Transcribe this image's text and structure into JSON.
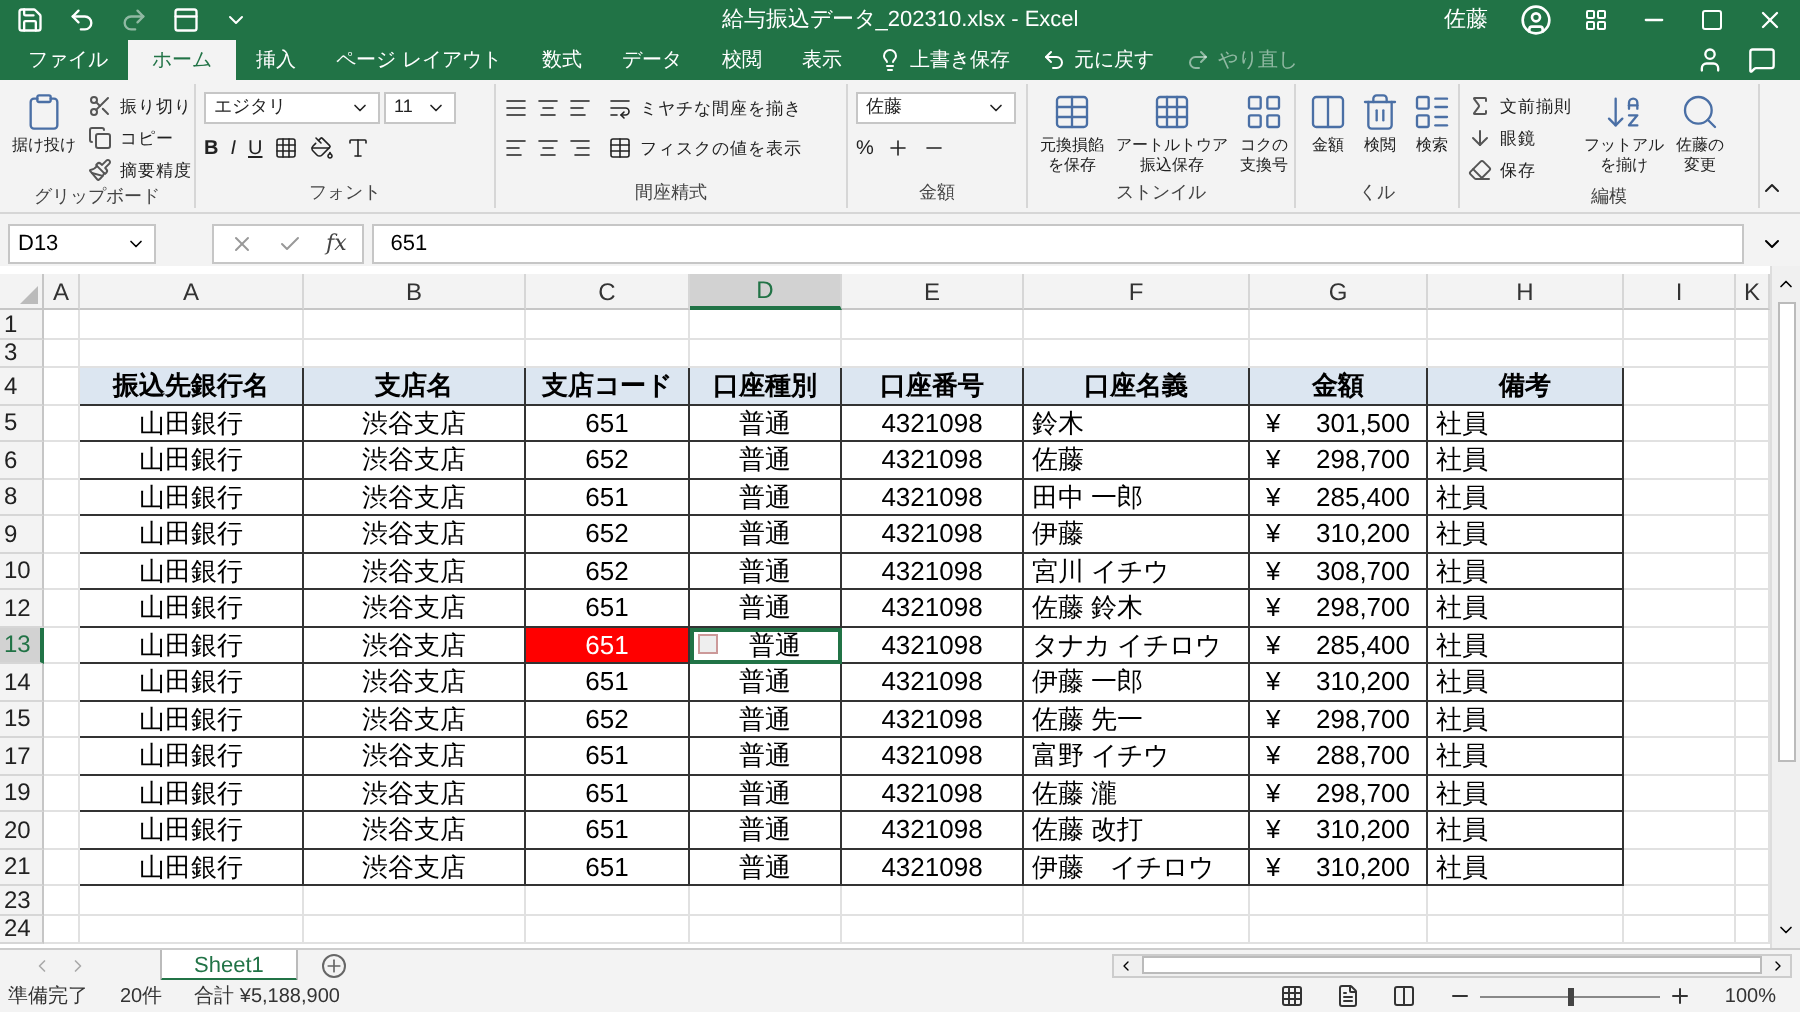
{
  "window": {
    "title": "給与振込データ_202310.xlsx - Excel",
    "user": "佐藤"
  },
  "ribbon_tabs": [
    {
      "label": "ファイル",
      "selected": false
    },
    {
      "label": "ホーム",
      "selected": true
    },
    {
      "label": "挿入",
      "selected": false
    },
    {
      "label": "ページ レイアウト",
      "selected": false
    },
    {
      "label": "数式",
      "selected": false
    },
    {
      "label": "データ",
      "selected": false
    },
    {
      "label": "校閲",
      "selected": false
    },
    {
      "label": "表示",
      "selected": false
    }
  ],
  "quick_commands": [
    {
      "label": "上書き保存",
      "disabled": false
    },
    {
      "label": "元に戻す",
      "disabled": false
    },
    {
      "label": "やり直し",
      "disabled": true
    }
  ],
  "ribbon_groups": [
    {
      "label": "グリップボード",
      "large": [
        {
          "lines": [
            "据け投け"
          ]
        }
      ],
      "small": [
        "振り切り",
        "コピー",
        "摘要精度"
      ]
    },
    {
      "label": "フォント",
      "fields": [
        "エジタリ",
        "11"
      ],
      "styles": [
        "B",
        "I",
        "U"
      ]
    },
    {
      "label": "間座精式",
      "small": [
        "ミヤチな間座を揃き",
        "フィスクの値を表示"
      ]
    },
    {
      "label": "金額",
      "fields": [
        "佐藤"
      ],
      "styles": [
        "%"
      ]
    },
    {
      "label": "ストンイル",
      "large": [
        {
          "lines": [
            "元換損餡",
            "を保存"
          ]
        },
        {
          "lines": [
            "アートルトウア",
            "振込保存"
          ]
        },
        {
          "lines": [
            "コクの",
            "支換号"
          ]
        }
      ]
    },
    {
      "label": "くル",
      "large": [
        {
          "lines": [
            "金額"
          ]
        },
        {
          "lines": [
            "検閲"
          ]
        },
        {
          "lines": [
            "検索"
          ]
        }
      ]
    },
    {
      "label": "編模",
      "small": [
        "文前揃則",
        "眼鏡",
        "保存"
      ],
      "large": [
        {
          "lines": [
            "フットアル",
            "を揃け"
          ]
        },
        {
          "lines": [
            "佐藤の",
            "変更"
          ]
        }
      ]
    }
  ],
  "formula_bar": {
    "name_box": "D13",
    "function_label": "fx",
    "value": "651"
  },
  "columns": [
    {
      "label": "A",
      "selected": false
    },
    {
      "label": "A",
      "selected": false
    },
    {
      "label": "B",
      "selected": false
    },
    {
      "label": "C",
      "selected": false
    },
    {
      "label": "D",
      "selected": true
    },
    {
      "label": "E",
      "selected": false
    },
    {
      "label": "F",
      "selected": false
    },
    {
      "label": "G",
      "selected": false
    },
    {
      "label": "H",
      "selected": false
    },
    {
      "label": "I",
      "selected": false
    },
    {
      "label": "K",
      "selected": false
    }
  ],
  "rows": [
    {
      "number": "1",
      "kind": "empty",
      "selected": false
    },
    {
      "number": "3",
      "kind": "empty",
      "selected": false
    },
    {
      "number": "4",
      "kind": "header",
      "selected": false,
      "cells": [
        "振込先銀行名",
        "支店名",
        "支店コード",
        "口座種別",
        "口座番号",
        "口座名義",
        "金額",
        "備考"
      ]
    },
    {
      "number": "5",
      "kind": "data",
      "selected": false,
      "cells": [
        "山田銀行",
        "渋谷支店",
        "651",
        "普通",
        "4321098",
        "鈴木"
      ],
      "currency": "¥",
      "amount": "301,500",
      "note": "社員"
    },
    {
      "number": "6",
      "kind": "data",
      "selected": false,
      "cells": [
        "山田銀行",
        "渋谷支店",
        "652",
        "普通",
        "4321098",
        "佐藤"
      ],
      "currency": "¥",
      "amount": "298,700",
      "note": "社員"
    },
    {
      "number": "8",
      "kind": "data",
      "selected": false,
      "cells": [
        "山田銀行",
        "渋谷支店",
        "651",
        "普通",
        "4321098",
        "田中 一郎"
      ],
      "currency": "¥",
      "amount": "285,400",
      "note": "社員"
    },
    {
      "number": "9",
      "kind": "data",
      "selected": false,
      "cells": [
        "山田銀行",
        "渋谷支店",
        "652",
        "普通",
        "4321098",
        "伊藤"
      ],
      "currency": "¥",
      "amount": "310,200",
      "note": "社員"
    },
    {
      "number": "10",
      "kind": "data",
      "selected": false,
      "cells": [
        "山田銀行",
        "渋谷支店",
        "652",
        "普通",
        "4321098",
        "宮川 イチウ"
      ],
      "currency": "¥",
      "amount": "308,700",
      "note": "社員"
    },
    {
      "number": "12",
      "kind": "data",
      "selected": false,
      "cells": [
        "山田銀行",
        "渋谷支店",
        "651",
        "普通",
        "4321098",
        "佐藤 鈴木"
      ],
      "currency": "¥",
      "amount": "298,700",
      "note": "社員"
    },
    {
      "number": "13",
      "kind": "data",
      "selected": true,
      "cells": [
        "山田銀行",
        "渋谷支店",
        {
          "text": "651",
          "color": "#ff0000"
        },
        "普通",
        "4321098",
        "タナカ イチロウ"
      ],
      "currency": "¥",
      "amount": "285,400",
      "note": "社員"
    },
    {
      "number": "14",
      "kind": "data",
      "selected": false,
      "cells": [
        "山田銀行",
        "渋谷支店",
        "651",
        "普通",
        "4321098",
        "伊藤 一郎"
      ],
      "currency": "¥",
      "amount": "310,200",
      "note": "社員"
    },
    {
      "number": "15",
      "kind": "data",
      "selected": false,
      "cells": [
        "山田銀行",
        "渋谷支店",
        "652",
        "普通",
        "4321098",
        "佐藤 先一"
      ],
      "currency": "¥",
      "amount": "298,700",
      "note": "社員"
    },
    {
      "number": "17",
      "kind": "data",
      "selected": false,
      "cells": [
        "山田銀行",
        "渋谷支店",
        "651",
        "普通",
        "4321098",
        "富野 イチウ"
      ],
      "currency": "¥",
      "amount": "288,700",
      "note": "社員"
    },
    {
      "number": "19",
      "kind": "data",
      "selected": false,
      "cells": [
        "山田銀行",
        "渋谷支店",
        "651",
        "普通",
        "4321098",
        "佐藤 瀧"
      ],
      "currency": "¥",
      "amount": "298,700",
      "note": "社員"
    },
    {
      "number": "20",
      "kind": "data",
      "selected": false,
      "cells": [
        "山田銀行",
        "渋谷支店",
        "651",
        "普通",
        "4321098",
        "佐藤 改打"
      ],
      "currency": "¥",
      "amount": "310,200",
      "note": "社員"
    },
    {
      "number": "21",
      "kind": "data",
      "selected": false,
      "cells": [
        "山田銀行",
        "渋谷支店",
        "651",
        "普通",
        "4321098",
        "伊藤　イチロウ"
      ],
      "currency": "¥",
      "amount": "310,200",
      "note": "社員"
    },
    {
      "number": "23",
      "kind": "empty",
      "selected": false
    },
    {
      "number": "24",
      "kind": "empty",
      "selected": false
    }
  ],
  "sheet_tabs": [
    {
      "label": "Sheet1",
      "selected": true
    }
  ],
  "status_bar": {
    "mode": "準備完了",
    "count": "20件",
    "sum": "合計 ¥5,188,900",
    "zoom": {
      "level": 0.5,
      "reading": "100%"
    }
  }
}
